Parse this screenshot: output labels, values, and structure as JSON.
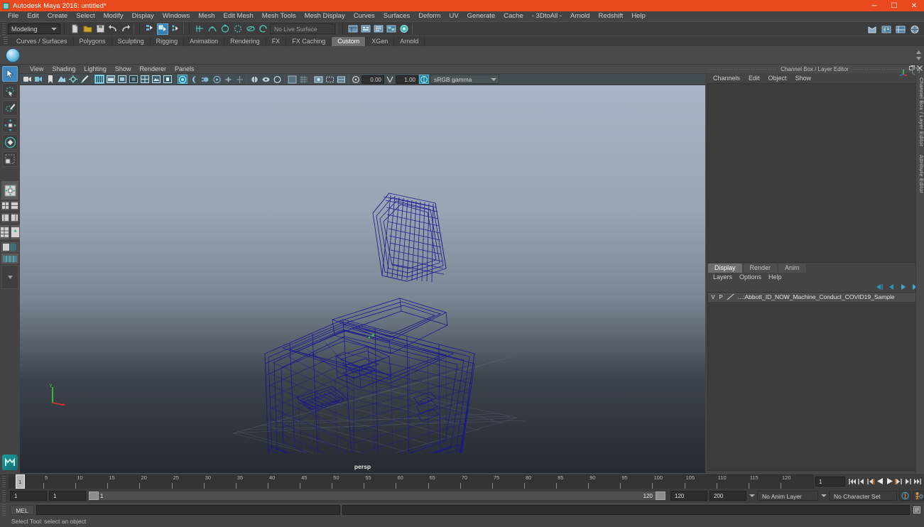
{
  "window": {
    "title": "Autodesk Maya 2016: untitled*",
    "logo_icon": "maya-logo-icon",
    "minimize_label": "─",
    "maximize_label": "☐",
    "close_label": "✕"
  },
  "menubar": {
    "items": [
      {
        "label": "File"
      },
      {
        "label": "Edit"
      },
      {
        "label": "Create"
      },
      {
        "label": "Select"
      },
      {
        "label": "Modify"
      },
      {
        "label": "Display"
      },
      {
        "label": "Windows"
      },
      {
        "label": "Mesh"
      },
      {
        "label": "Edit Mesh"
      },
      {
        "label": "Mesh Tools"
      },
      {
        "label": "Mesh Display"
      },
      {
        "label": "Curves"
      },
      {
        "label": "Surfaces"
      },
      {
        "label": "Deform"
      },
      {
        "label": "UV"
      },
      {
        "label": "Generate"
      },
      {
        "label": "Cache"
      },
      {
        "label": "- 3DtoAll -"
      },
      {
        "label": "Arnold"
      },
      {
        "label": "Redshift"
      },
      {
        "label": "Help"
      }
    ]
  },
  "statusbar": {
    "menuset": "Modeling",
    "live_surface": "No Live Surface",
    "icons": [
      "new-scene-icon",
      "open-scene-icon",
      "save-scene-icon",
      "undo-icon",
      "redo-icon",
      "select-by-hierarchy-icon",
      "select-by-object-icon",
      "select-by-component-icon",
      "snap-grid-icon",
      "snap-curve-icon",
      "snap-point-icon",
      "snap-projected-icon",
      "snap-view-plane-icon",
      "make-live-icon",
      "show-hide-editor-icon",
      "show-hide-render-icon",
      "show-hide-hypergraph-icon",
      "show-hide-outliner-icon",
      "show-hide-attribute-icon"
    ],
    "right_icons": [
      "render-view-icon",
      "render-settings-icon",
      "hypershade-icon",
      "ipr-render-icon"
    ]
  },
  "shelf": {
    "tabs": [
      {
        "label": "Curves / Surfaces",
        "active": false
      },
      {
        "label": "Polygons",
        "active": false
      },
      {
        "label": "Sculpting",
        "active": false
      },
      {
        "label": "Rigging",
        "active": false
      },
      {
        "label": "Animation",
        "active": false
      },
      {
        "label": "Rendering",
        "active": false
      },
      {
        "label": "FX",
        "active": false
      },
      {
        "label": "FX Caching",
        "active": false
      },
      {
        "label": "Custom",
        "active": true
      },
      {
        "label": "XGen",
        "active": false
      },
      {
        "label": "Arnold",
        "active": false
      }
    ],
    "item_icon": "custom-shelf-sphere-icon"
  },
  "toolbox": {
    "tools": [
      {
        "name": "select-tool",
        "selected": true
      },
      {
        "name": "lasso-select-tool",
        "selected": false
      },
      {
        "name": "paint-select-tool",
        "selected": false
      },
      {
        "name": "move-tool",
        "selected": false
      },
      {
        "name": "rotate-tool",
        "selected": false
      },
      {
        "name": "scale-tool",
        "selected": false
      }
    ],
    "layout_presets": [
      "single-perspective-layout",
      "four-view-layout",
      "two-pane-stacked-layout",
      "outliner-persp-layout",
      "persp-graph-layout",
      "hypershade-persp-layout",
      "persp-render-layout",
      "quad-split-layout"
    ],
    "logo_icon": "maya-m-logo-icon"
  },
  "viewport": {
    "menus": [
      {
        "label": "View"
      },
      {
        "label": "Shading"
      },
      {
        "label": "Lighting"
      },
      {
        "label": "Show"
      },
      {
        "label": "Renderer"
      },
      {
        "label": "Panels"
      }
    ],
    "camera_label": "persp",
    "exposure_value": "0.00",
    "gamma_value": "1.00",
    "color_profile": "sRGB gamma",
    "toolbar_icons": [
      "select-camera-icon",
      "camera-attributes-icon",
      "bookmark-icon",
      "image-plane-icon",
      "two-d-pan-zoom-icon",
      "grease-pencil-icon",
      "wireframe-shading-icon",
      "smooth-shade-all-icon",
      "smooth-shade-selected-icon",
      "flat-shade-icon",
      "shaded-wireframe-icon",
      "textured-icon",
      "light-shading-icon",
      "shadows-icon",
      "screen-space-ao-icon",
      "motion-blur-icon",
      "multisample-aa-icon",
      "depth-of-field-icon",
      "isolate-select-icon",
      "xray-icon",
      "xray-joints-icon",
      "xray-active-components-icon",
      "exposure-icon",
      "gamma-icon",
      "view-transform-icon"
    ],
    "model_name": "Abbott ID NOW Machine wireframe",
    "wireframe_color": "#1a1a8c",
    "background_top": "#aab4c4",
    "background_bottom": "#262a31"
  },
  "channel_box": {
    "panel_title": "Channel Box / Layer Editor",
    "menus": [
      {
        "label": "Channels"
      },
      {
        "label": "Edit"
      },
      {
        "label": "Object"
      },
      {
        "label": "Show"
      }
    ],
    "undock_icon": "undock-icon",
    "close_icon": "close-panel-icon",
    "manip_icons": [
      "manipulator-icon",
      "no-manipulator-icon"
    ],
    "side_tabs": [
      {
        "label": "Channel Box / Layer Editor"
      },
      {
        "label": "Attribute Editor"
      }
    ]
  },
  "layer_editor": {
    "tabs": [
      {
        "label": "Display",
        "active": true
      },
      {
        "label": "Render",
        "active": false
      },
      {
        "label": "Anim",
        "active": false
      }
    ],
    "menus": [
      {
        "label": "Layers"
      },
      {
        "label": "Options"
      },
      {
        "label": "Help"
      }
    ],
    "toolbar_icons": [
      "layer-first-icon",
      "layer-prev-icon",
      "layer-next-icon",
      "layer-new-icon"
    ],
    "layers": [
      {
        "visibility": "V",
        "playback": "P",
        "swatch_icon": "layer-color-icon",
        "name": "...:Abbott_ID_NOW_Machine_Conduct_COVID19_Sample"
      }
    ]
  },
  "timeline": {
    "start": 1,
    "end": 120,
    "current_frame": "1",
    "tick_labels": [
      "5",
      "10",
      "15",
      "20",
      "25",
      "30",
      "35",
      "40",
      "45",
      "50",
      "55",
      "60",
      "65",
      "70",
      "75",
      "80",
      "85",
      "90",
      "95",
      "100",
      "105",
      "110",
      "115",
      "120"
    ],
    "current_frame_field": "1",
    "playback_buttons": [
      "go-to-start-icon",
      "step-back-frame-icon",
      "step-back-key-icon",
      "play-backwards-icon",
      "play-forwards-icon",
      "step-forward-key-icon",
      "step-forward-frame-icon",
      "go-to-end-icon"
    ]
  },
  "range_slider": {
    "anim_start": "1",
    "range_start": "1",
    "range_start_handle": "1",
    "range_end_handle": "120",
    "range_end": "120",
    "anim_end": "200",
    "anim_layer": "No Anim Layer",
    "character_set": "No Character Set",
    "auto_key_icon": "auto-keyframe-icon",
    "anim_prefs_icon": "animation-preferences-icon"
  },
  "command_line": {
    "language": "MEL",
    "input_value": "",
    "result_value": "",
    "script_editor_icon": "script-editor-icon"
  },
  "help_line": {
    "text": "Select Tool: select an object"
  }
}
